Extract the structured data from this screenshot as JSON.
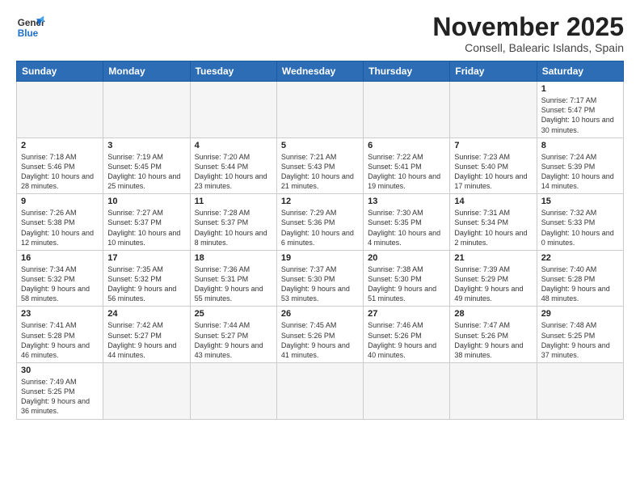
{
  "logo": {
    "line1": "General",
    "line2": "Blue"
  },
  "header": {
    "month": "November 2025",
    "location": "Consell, Balearic Islands, Spain"
  },
  "weekdays": [
    "Sunday",
    "Monday",
    "Tuesday",
    "Wednesday",
    "Thursday",
    "Friday",
    "Saturday"
  ],
  "weeks": [
    [
      {
        "day": "",
        "info": ""
      },
      {
        "day": "",
        "info": ""
      },
      {
        "day": "",
        "info": ""
      },
      {
        "day": "",
        "info": ""
      },
      {
        "day": "",
        "info": ""
      },
      {
        "day": "",
        "info": ""
      },
      {
        "day": "1",
        "info": "Sunrise: 7:17 AM\nSunset: 5:47 PM\nDaylight: 10 hours and 30 minutes."
      }
    ],
    [
      {
        "day": "2",
        "info": "Sunrise: 7:18 AM\nSunset: 5:46 PM\nDaylight: 10 hours and 28 minutes."
      },
      {
        "day": "3",
        "info": "Sunrise: 7:19 AM\nSunset: 5:45 PM\nDaylight: 10 hours and 25 minutes."
      },
      {
        "day": "4",
        "info": "Sunrise: 7:20 AM\nSunset: 5:44 PM\nDaylight: 10 hours and 23 minutes."
      },
      {
        "day": "5",
        "info": "Sunrise: 7:21 AM\nSunset: 5:43 PM\nDaylight: 10 hours and 21 minutes."
      },
      {
        "day": "6",
        "info": "Sunrise: 7:22 AM\nSunset: 5:41 PM\nDaylight: 10 hours and 19 minutes."
      },
      {
        "day": "7",
        "info": "Sunrise: 7:23 AM\nSunset: 5:40 PM\nDaylight: 10 hours and 17 minutes."
      },
      {
        "day": "8",
        "info": "Sunrise: 7:24 AM\nSunset: 5:39 PM\nDaylight: 10 hours and 14 minutes."
      }
    ],
    [
      {
        "day": "9",
        "info": "Sunrise: 7:26 AM\nSunset: 5:38 PM\nDaylight: 10 hours and 12 minutes."
      },
      {
        "day": "10",
        "info": "Sunrise: 7:27 AM\nSunset: 5:37 PM\nDaylight: 10 hours and 10 minutes."
      },
      {
        "day": "11",
        "info": "Sunrise: 7:28 AM\nSunset: 5:37 PM\nDaylight: 10 hours and 8 minutes."
      },
      {
        "day": "12",
        "info": "Sunrise: 7:29 AM\nSunset: 5:36 PM\nDaylight: 10 hours and 6 minutes."
      },
      {
        "day": "13",
        "info": "Sunrise: 7:30 AM\nSunset: 5:35 PM\nDaylight: 10 hours and 4 minutes."
      },
      {
        "day": "14",
        "info": "Sunrise: 7:31 AM\nSunset: 5:34 PM\nDaylight: 10 hours and 2 minutes."
      },
      {
        "day": "15",
        "info": "Sunrise: 7:32 AM\nSunset: 5:33 PM\nDaylight: 10 hours and 0 minutes."
      }
    ],
    [
      {
        "day": "16",
        "info": "Sunrise: 7:34 AM\nSunset: 5:32 PM\nDaylight: 9 hours and 58 minutes."
      },
      {
        "day": "17",
        "info": "Sunrise: 7:35 AM\nSunset: 5:32 PM\nDaylight: 9 hours and 56 minutes."
      },
      {
        "day": "18",
        "info": "Sunrise: 7:36 AM\nSunset: 5:31 PM\nDaylight: 9 hours and 55 minutes."
      },
      {
        "day": "19",
        "info": "Sunrise: 7:37 AM\nSunset: 5:30 PM\nDaylight: 9 hours and 53 minutes."
      },
      {
        "day": "20",
        "info": "Sunrise: 7:38 AM\nSunset: 5:30 PM\nDaylight: 9 hours and 51 minutes."
      },
      {
        "day": "21",
        "info": "Sunrise: 7:39 AM\nSunset: 5:29 PM\nDaylight: 9 hours and 49 minutes."
      },
      {
        "day": "22",
        "info": "Sunrise: 7:40 AM\nSunset: 5:28 PM\nDaylight: 9 hours and 48 minutes."
      }
    ],
    [
      {
        "day": "23",
        "info": "Sunrise: 7:41 AM\nSunset: 5:28 PM\nDaylight: 9 hours and 46 minutes."
      },
      {
        "day": "24",
        "info": "Sunrise: 7:42 AM\nSunset: 5:27 PM\nDaylight: 9 hours and 44 minutes."
      },
      {
        "day": "25",
        "info": "Sunrise: 7:44 AM\nSunset: 5:27 PM\nDaylight: 9 hours and 43 minutes."
      },
      {
        "day": "26",
        "info": "Sunrise: 7:45 AM\nSunset: 5:26 PM\nDaylight: 9 hours and 41 minutes."
      },
      {
        "day": "27",
        "info": "Sunrise: 7:46 AM\nSunset: 5:26 PM\nDaylight: 9 hours and 40 minutes."
      },
      {
        "day": "28",
        "info": "Sunrise: 7:47 AM\nSunset: 5:26 PM\nDaylight: 9 hours and 38 minutes."
      },
      {
        "day": "29",
        "info": "Sunrise: 7:48 AM\nSunset: 5:25 PM\nDaylight: 9 hours and 37 minutes."
      }
    ],
    [
      {
        "day": "30",
        "info": "Sunrise: 7:49 AM\nSunset: 5:25 PM\nDaylight: 9 hours and 36 minutes."
      },
      {
        "day": "",
        "info": ""
      },
      {
        "day": "",
        "info": ""
      },
      {
        "day": "",
        "info": ""
      },
      {
        "day": "",
        "info": ""
      },
      {
        "day": "",
        "info": ""
      },
      {
        "day": "",
        "info": ""
      }
    ]
  ]
}
